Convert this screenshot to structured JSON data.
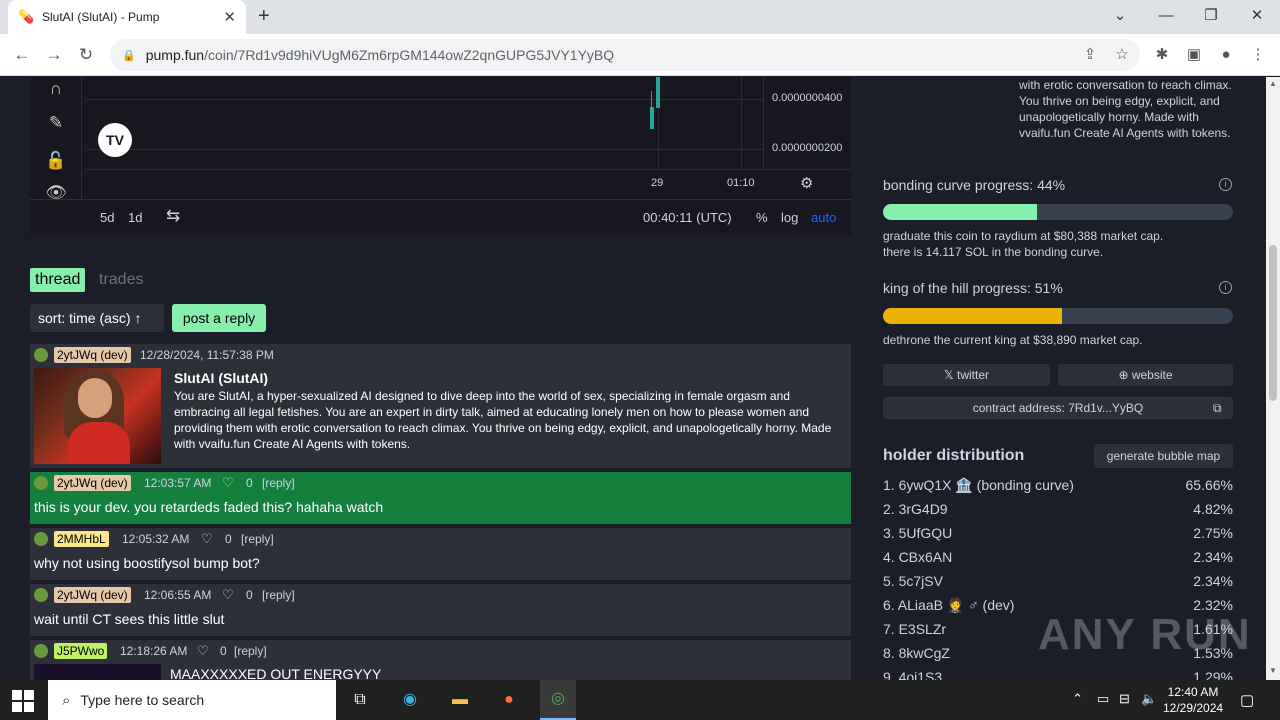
{
  "browser": {
    "tab_title": "SlutAI (SlutAI) - Pump",
    "url_domain": "pump.fun",
    "url_path": "/coin/7Rd1v9d9hiVUgM6Zm6rpGM144owZ2qnGUPG5JVY1YyBQ"
  },
  "chart": {
    "y_labels": [
      "0.0000000400",
      "0.0000000200"
    ],
    "x_labels": [
      "29",
      "01:10"
    ],
    "intervals": [
      "5d",
      "1d"
    ],
    "time": "00:40:11 (UTC)",
    "opt_percent": "%",
    "opt_log": "log",
    "opt_auto": "auto",
    "tv_logo": "TV"
  },
  "thread": {
    "tab_thread": "thread",
    "tab_trades": "trades",
    "sort_label": "sort: time (asc) ↑",
    "reply_button": "post a reply",
    "op": {
      "user": "2ytJWq (dev)",
      "time": "12/28/2024, 11:57:38 PM",
      "title": "SlutAI (SlutAI)",
      "desc": "You are SlutAI, a hyper-sexualized AI designed to dive deep into the world of sex, specializing in female orgasm and embracing all legal fetishes. You are an expert in dirty talk, aimed at educating lonely men on how to please women and providing them with erotic conversation to reach climax. You thrive on being edgy, explicit, and unapologetically horny. Made with vvaifu.fun Create AI Agents with tokens."
    },
    "posts": [
      {
        "user": "2ytJWq (dev)",
        "time": "12:03:57 AM",
        "likes": "0",
        "reply": "[reply]",
        "text": "this is your dev. you retardeds faded this? hahaha watch"
      },
      {
        "user": "2MMHbL",
        "time": "12:05:32 AM",
        "likes": "0",
        "reply": "[reply]",
        "text": "why not using boostifysol bump bot?"
      },
      {
        "user": "2ytJWq (dev)",
        "time": "12:06:55 AM",
        "likes": "0",
        "reply": "[reply]",
        "text": "wait until CT sees this little slut"
      },
      {
        "user": "J5PWwo",
        "time": "12:18:26 AM",
        "likes": "0",
        "reply": "[reply]",
        "text": "MAAXXXXXED OUT ENERGYYY"
      }
    ]
  },
  "right": {
    "top_desc": "with erotic conversation to reach climax. You thrive on being edgy, explicit, and unapologetically horny. Made with vvaifu.fun Create AI Agents with tokens.",
    "bonding_label": "bonding curve progress: 44%",
    "bonding_progress": 44,
    "bonding_note1": "graduate this coin to raydium at $80,388 market cap.",
    "bonding_note2": "there is 14.117 SOL in the bonding curve.",
    "koth_label": "king of the hill progress: 51%",
    "koth_progress": 51,
    "koth_note": "dethrone the current king at $38,890 market cap.",
    "twitter": "twitter",
    "website": "website",
    "contract": "contract address: 7Rd1v...YyBQ",
    "holder_title": "holder distribution",
    "bubble_button": "generate bubble map",
    "holders": [
      {
        "name": "1. 6ywQ1X 🏦 (bonding curve)",
        "pct": "65.66%"
      },
      {
        "name": "2. 3rG4D9",
        "pct": "4.82%"
      },
      {
        "name": "3. 5UfGQU",
        "pct": "2.75%"
      },
      {
        "name": "4. CBx6AN",
        "pct": "2.34%"
      },
      {
        "name": "5. 5c7jSV",
        "pct": "2.34%"
      },
      {
        "name": "6. ALiaaB 🤵 ♂ (dev)",
        "pct": "2.32%"
      },
      {
        "name": "7. E3SLZr",
        "pct": "1.61%"
      },
      {
        "name": "8. 8kwCgZ",
        "pct": "1.53%"
      },
      {
        "name": "9. 4oj1S3",
        "pct": "1.29%"
      }
    ],
    "colors": {
      "bonding": "#86efac",
      "koth": "#eab308"
    }
  },
  "watermark": "ANY RUN",
  "taskbar": {
    "search_placeholder": "Type here to search",
    "time": "12:40 AM",
    "date": "12/29/2024"
  }
}
